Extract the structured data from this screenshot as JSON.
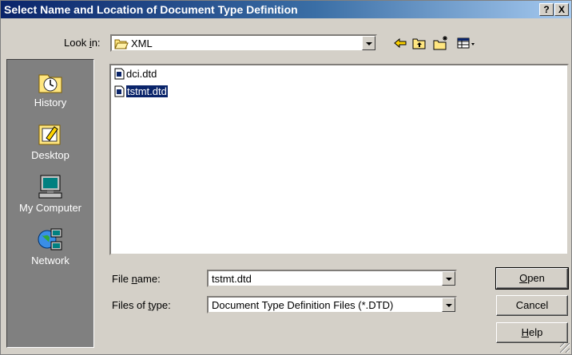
{
  "window": {
    "title": "Select Name and Location of Document Type Definition",
    "help_button": "?",
    "close_button": "X"
  },
  "look_in": {
    "label_pre": "Look ",
    "label_accel": "i",
    "label_post": "n:",
    "value": "XML"
  },
  "toolbar": {
    "icons": [
      "back-icon",
      "up-folder-icon",
      "new-folder-icon",
      "view-menu-icon"
    ]
  },
  "places": [
    {
      "label": "History",
      "icon": "history-icon"
    },
    {
      "label": "Desktop",
      "icon": "desktop-icon"
    },
    {
      "label": "My Computer",
      "icon": "my-computer-icon"
    },
    {
      "label": "Network",
      "icon": "network-icon"
    }
  ],
  "files": [
    {
      "name": "dci.dtd",
      "selected": false
    },
    {
      "name": "tstmt.dtd",
      "selected": true
    }
  ],
  "file_name": {
    "label_pre": "File ",
    "label_accel": "n",
    "label_post": "ame:",
    "value": "tstmt.dtd"
  },
  "file_type": {
    "label_pre": "Files of ",
    "label_accel": "t",
    "label_post": "ype:",
    "value": "Document Type Definition Files (*.DTD)"
  },
  "buttons": {
    "open_accel": "O",
    "open_rest": "pen",
    "cancel": "Cancel",
    "help_accel": "H",
    "help_rest": "elp"
  },
  "colors": {
    "face": "#d4d0c8",
    "title_active": "#0a246a",
    "selection": "#0a246a",
    "places_bg": "#808080"
  }
}
